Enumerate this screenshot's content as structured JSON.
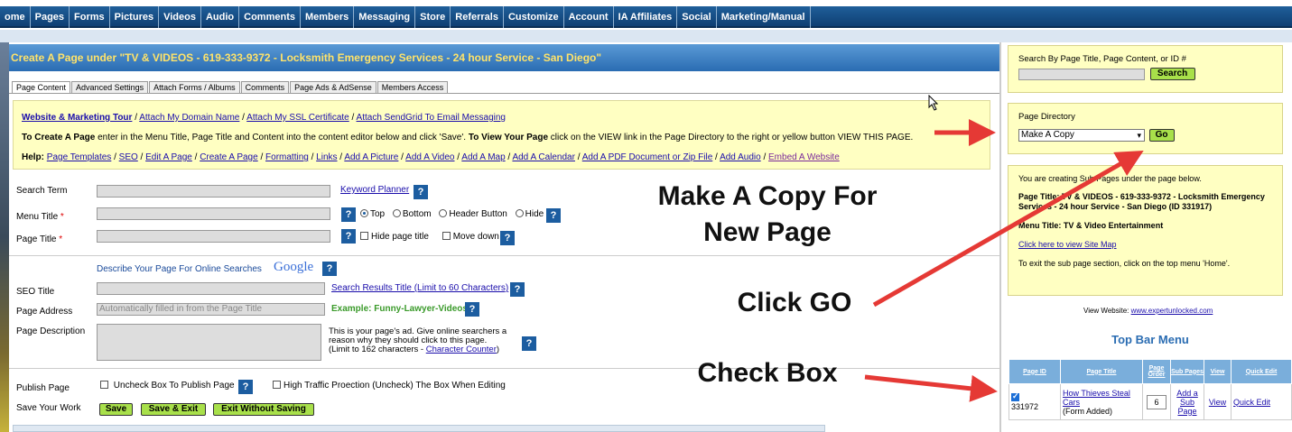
{
  "nav": {
    "items": [
      "ome",
      "Pages",
      "Forms",
      "Pictures",
      "Videos",
      "Audio",
      "Comments",
      "Members",
      "Messaging",
      "Store",
      "Referrals",
      "Customize",
      "Account",
      "IA Affiliates",
      "Social",
      "Marketing/Manual"
    ]
  },
  "header": {
    "title": "Create A Page under \"TV & VIDEOS - 619-333-9372 - Locksmith Emergency Services - 24 hour Service - San Diego\""
  },
  "tabs": [
    "Page Content",
    "Advanced Settings",
    "Attach Forms / Albums",
    "Comments",
    "Page Ads & AdSense",
    "Members Access"
  ],
  "info": {
    "links1": [
      "Website & Marketing Tour",
      "Attach My Domain Name",
      "Attach My SSL Certificate",
      "Attach SendGrid To Email Messaging"
    ],
    "line2_a": "To Create A Page",
    "line2_b": " enter in the Menu Title, Page Title and Content into the content editor below and click 'Save'. ",
    "line2_c": "To View Your Page",
    "line2_d": " click on the VIEW link in the Page Directory to the right or yellow button VIEW THIS PAGE.",
    "help_label": "Help:",
    "help_links": [
      "Page Templates",
      "SEO",
      "Edit A Page",
      "Create A Page",
      "Formatting",
      "Links",
      "Add A Picture",
      "Add A Video",
      "Add A Map",
      "Add A Calendar",
      "Add A PDF Document or Zip File",
      "Add Audio"
    ],
    "help_last": "Embed A Website"
  },
  "form": {
    "search_term": "Search Term",
    "keyword_planner": "Keyword Planner",
    "menu_title": "Menu Title",
    "page_title": "Page Title",
    "radio_top": "Top",
    "radio_bottom": "Bottom",
    "radio_header": "Header Button",
    "radio_hide": "Hide",
    "hide_page_title": "Hide page title",
    "move_down": "Move down",
    "describe": "Describe Your Page For Online Searches",
    "google": "Google",
    "seo_title": "SEO Title",
    "search_results_title": "Search Results Title (Limit to 60 Characters)",
    "page_address": "Page Address",
    "page_address_placeholder": "Automatically filled in from the Page Title",
    "example_label": "Example: ",
    "example_value": "Funny-Lawyer-Videos",
    "page_description": "Page Description",
    "desc_help": "This is your page's ad. Give online searchers a reason why they should click to this page.",
    "desc_limit": "(Limit to 162 characters - ",
    "char_counter": "Character Counter",
    "desc_limit_end": ")",
    "publish_page": "Publish Page",
    "uncheck_publish": "Uncheck Box To Publish Page",
    "high_traffic": "High Traffic Proection (Uncheck) The Box When Editing",
    "save_your_work": "Save Your Work",
    "save": "Save",
    "save_exit": "Save & Exit",
    "exit_without_saving": "Exit Without Saving"
  },
  "annotations": {
    "make_copy_line1": "Make A Copy For",
    "make_copy_line2": "New Page",
    "click_go": "Click GO",
    "check_box": "Check Box"
  },
  "sidebar": {
    "search_label": "Search By Page Title, Page Content, or ID #",
    "search_button": "Search",
    "dir_label": "Page Directory",
    "dir_selected": "Make A Copy",
    "go_button": "Go",
    "creating_text": "You are creating Sub Pages under the page below.",
    "page_title_info": "Page Title: TV & VIDEOS - 619-333-9372 - Locksmith Emergency Services - 24 hour Service - San Diego (ID 331917)",
    "menu_title_info": "Menu Title: TV & Video Entertainment",
    "site_map_link": "Click here to view Site Map",
    "exit_text": "To exit the sub page section, click on the top menu 'Home'.",
    "view_website_label": "View Website: ",
    "view_website_link": "www.expertunlocked.com",
    "top_bar_menu": "Top Bar Menu"
  },
  "table": {
    "headers": [
      "Page ID",
      "Page Title",
      "Page Order",
      "Sub Pages",
      "View",
      "Quick Edit"
    ],
    "row": {
      "id": "331972",
      "title": "How Thieves Steal Cars",
      "note": "(Form Added)",
      "order": "6",
      "sub": "Add a Sub Page",
      "view": "View",
      "edit": "Quick Edit"
    }
  },
  "colors": {
    "nav": "#1f5f9a",
    "header_text": "#ffe36a",
    "yellow_box": "#ffffc2",
    "button_green": "#a8e04a",
    "arrow": "#e53935"
  }
}
